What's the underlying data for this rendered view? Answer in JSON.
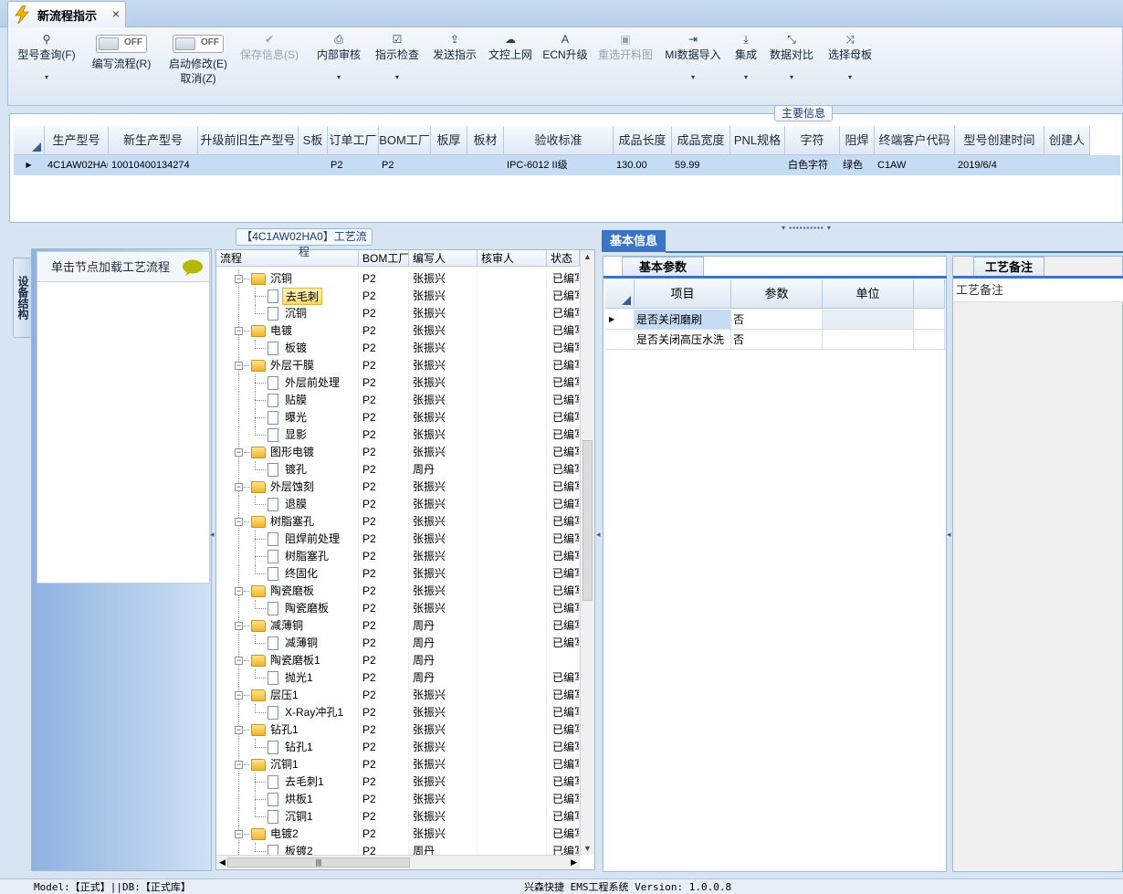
{
  "window": {
    "tab_title": "新流程指示",
    "close_glyph": "×"
  },
  "toolbar": {
    "buttons": [
      {
        "label": "型号查询(F)",
        "icon": "search-icon",
        "glyph": "⚲",
        "dropdown": true,
        "disabled": false
      },
      {
        "label": "编写流程(R)",
        "toggle_state": "OFF"
      },
      {
        "label": "启动修改(E)",
        "label2": "取消(Z)",
        "toggle_state": "OFF"
      },
      {
        "label": "保存信息(S)",
        "icon": "check-icon",
        "glyph": "✔",
        "disabled": true
      },
      {
        "label": "内部审核",
        "icon": "print-icon",
        "glyph": "⎙",
        "dropdown": true
      },
      {
        "label": "指示检查",
        "icon": "checkbox-icon",
        "glyph": "☑",
        "dropdown": true
      },
      {
        "label": "发送指示",
        "icon": "upload-icon",
        "glyph": "⇪"
      },
      {
        "label": "文控上网",
        "icon": "cloud-upload-icon",
        "glyph": "☁"
      },
      {
        "label": "ECN升级",
        "icon": "font-icon",
        "glyph": "A"
      },
      {
        "label": "重选开料图",
        "icon": "image-icon",
        "glyph": "▣",
        "disabled": true
      },
      {
        "label": "MI数据导入",
        "icon": "import-icon",
        "glyph": "⇥",
        "dropdown": true
      },
      {
        "label": "集成",
        "icon": "download-icon",
        "glyph": "⤓",
        "dropdown": true
      },
      {
        "label": "数据对比",
        "icon": "compress-icon",
        "glyph": "⤡",
        "dropdown": true
      },
      {
        "label": "选择母板",
        "icon": "shuffle-icon",
        "glyph": "⤨",
        "dropdown": true
      }
    ],
    "dropdown_glyph": "▾"
  },
  "main_info": {
    "caption": "主要信息",
    "columns": [
      "生产型号",
      "新生产型号",
      "升级前旧生产型号",
      "S板",
      "订单工厂",
      "BOM工厂",
      "板厚",
      "板材",
      "验收标准",
      "成品长度",
      "成品宽度",
      "PNL规格",
      "字符",
      "阻焊",
      "终端客户代码",
      "型号创建时间",
      "创建人"
    ],
    "row": [
      "4C1AW02HA0",
      "10010400134274",
      "",
      "",
      "P2",
      "P2",
      "",
      "",
      "IPC-6012 II级",
      "130.00",
      "59.99",
      "",
      "白色字符",
      "绿色",
      "C1AW",
      "2019/6/4",
      ""
    ],
    "row_indicator": "▶"
  },
  "left_panel": {
    "side_tab": "设备结构",
    "node_header": "单击节点加载工艺流程"
  },
  "tree": {
    "caption": "【4C1AW02HA0】工艺流程",
    "columns": [
      "流程",
      "BOM工厂",
      "编写人",
      "核审人",
      "状态"
    ],
    "rows": [
      {
        "name": "沉铜",
        "level": 0,
        "type": "folder",
        "bom": "P2",
        "writer": "张振兴",
        "checker": "",
        "status": "已编写"
      },
      {
        "name": "去毛刺",
        "level": 1,
        "type": "doc",
        "bom": "P2",
        "writer": "张振兴",
        "checker": "",
        "status": "已编写",
        "selected": true
      },
      {
        "name": "沉铜",
        "level": 1,
        "type": "doc",
        "bom": "P2",
        "writer": "张振兴",
        "checker": "",
        "status": "已编写",
        "last": true
      },
      {
        "name": "电镀",
        "level": 0,
        "type": "folder",
        "bom": "P2",
        "writer": "张振兴",
        "checker": "",
        "status": "已编写"
      },
      {
        "name": "板镀",
        "level": 1,
        "type": "doc",
        "bom": "P2",
        "writer": "张振兴",
        "checker": "",
        "status": "已编写",
        "last": true
      },
      {
        "name": "外层干膜",
        "level": 0,
        "type": "folder",
        "bom": "P2",
        "writer": "张振兴",
        "checker": "",
        "status": "已编写"
      },
      {
        "name": "外层前处理",
        "level": 1,
        "type": "doc",
        "bom": "P2",
        "writer": "张振兴",
        "checker": "",
        "status": "已编写"
      },
      {
        "name": "贴膜",
        "level": 1,
        "type": "doc",
        "bom": "P2",
        "writer": "张振兴",
        "checker": "",
        "status": "已编写"
      },
      {
        "name": "曝光",
        "level": 1,
        "type": "doc",
        "bom": "P2",
        "writer": "张振兴",
        "checker": "",
        "status": "已编写"
      },
      {
        "name": "显影",
        "level": 1,
        "type": "doc",
        "bom": "P2",
        "writer": "张振兴",
        "checker": "",
        "status": "已编写",
        "last": true
      },
      {
        "name": "图形电镀",
        "level": 0,
        "type": "folder",
        "bom": "P2",
        "writer": "张振兴",
        "checker": "",
        "status": "已编写"
      },
      {
        "name": "镀孔",
        "level": 1,
        "type": "doc",
        "bom": "P2",
        "writer": "周丹",
        "checker": "",
        "status": "已编写",
        "last": true
      },
      {
        "name": "外层蚀刻",
        "level": 0,
        "type": "folder",
        "bom": "P2",
        "writer": "张振兴",
        "checker": "",
        "status": "已编写"
      },
      {
        "name": "退膜",
        "level": 1,
        "type": "doc",
        "bom": "P2",
        "writer": "张振兴",
        "checker": "",
        "status": "已编写",
        "last": true
      },
      {
        "name": "树脂塞孔",
        "level": 0,
        "type": "folder",
        "bom": "P2",
        "writer": "张振兴",
        "checker": "",
        "status": "已编写"
      },
      {
        "name": "阻焊前处理",
        "level": 1,
        "type": "doc",
        "bom": "P2",
        "writer": "张振兴",
        "checker": "",
        "status": "已编写"
      },
      {
        "name": "树脂塞孔",
        "level": 1,
        "type": "doc",
        "bom": "P2",
        "writer": "张振兴",
        "checker": "",
        "status": "已编写"
      },
      {
        "name": "终固化",
        "level": 1,
        "type": "doc",
        "bom": "P2",
        "writer": "张振兴",
        "checker": "",
        "status": "已编写",
        "last": true
      },
      {
        "name": "陶瓷磨板",
        "level": 0,
        "type": "folder",
        "bom": "P2",
        "writer": "张振兴",
        "checker": "",
        "status": "已编写"
      },
      {
        "name": "陶瓷磨板",
        "level": 1,
        "type": "doc",
        "bom": "P2",
        "writer": "张振兴",
        "checker": "",
        "status": "已编写",
        "last": true
      },
      {
        "name": "减薄铜",
        "level": 0,
        "type": "folder",
        "bom": "P2",
        "writer": "周丹",
        "checker": "",
        "status": "已编写"
      },
      {
        "name": "减薄铜",
        "level": 1,
        "type": "doc",
        "bom": "P2",
        "writer": "周丹",
        "checker": "",
        "status": "已编写",
        "last": true
      },
      {
        "name": "陶瓷磨板1",
        "level": 0,
        "type": "folder",
        "bom": "P2",
        "writer": "周丹",
        "checker": "",
        "status": ""
      },
      {
        "name": "抛光1",
        "level": 1,
        "type": "doc",
        "bom": "P2",
        "writer": "周丹",
        "checker": "",
        "status": "已编写",
        "last": true
      },
      {
        "name": "层压1",
        "level": 0,
        "type": "folder",
        "bom": "P2",
        "writer": "张振兴",
        "checker": "",
        "status": "已编写"
      },
      {
        "name": "X-Ray冲孔1",
        "level": 1,
        "type": "doc",
        "bom": "P2",
        "writer": "张振兴",
        "checker": "",
        "status": "已编写",
        "last": true
      },
      {
        "name": "钻孔1",
        "level": 0,
        "type": "folder",
        "bom": "P2",
        "writer": "张振兴",
        "checker": "",
        "status": "已编写"
      },
      {
        "name": "钻孔1",
        "level": 1,
        "type": "doc",
        "bom": "P2",
        "writer": "张振兴",
        "checker": "",
        "status": "已编写",
        "last": true
      },
      {
        "name": "沉铜1",
        "level": 0,
        "type": "folder",
        "bom": "P2",
        "writer": "张振兴",
        "checker": "",
        "status": "已编写"
      },
      {
        "name": "去毛刺1",
        "level": 1,
        "type": "doc",
        "bom": "P2",
        "writer": "张振兴",
        "checker": "",
        "status": "已编写"
      },
      {
        "name": "烘板1",
        "level": 1,
        "type": "doc",
        "bom": "P2",
        "writer": "张振兴",
        "checker": "",
        "status": "已编写"
      },
      {
        "name": "沉铜1",
        "level": 1,
        "type": "doc",
        "bom": "P2",
        "writer": "张振兴",
        "checker": "",
        "status": "已编写",
        "last": true
      },
      {
        "name": "电镀2",
        "level": 0,
        "type": "folder",
        "bom": "P2",
        "writer": "张振兴",
        "checker": "",
        "status": "已编写"
      },
      {
        "name": "板镀2",
        "level": 1,
        "type": "doc",
        "bom": "P2",
        "writer": "周丹",
        "checker": "",
        "status": "已编写",
        "last": true
      }
    ]
  },
  "basic_info": {
    "title": "基本信息",
    "params_tab": "基本参数",
    "columns": [
      "项目",
      "参数",
      "单位"
    ],
    "rows": [
      {
        "item": "是否关闭磨刷",
        "value": "否",
        "unit": ""
      },
      {
        "item": "是否关闭高压水洗",
        "value": "否",
        "unit": ""
      }
    ],
    "notes_tab": "工艺备注",
    "notes_label": "工艺备注"
  },
  "statusbar": {
    "left": "Model:【正式】||DB:【正式库】",
    "right": "兴森快捷 EMS工程系统 Version: 1.0.0.8"
  }
}
